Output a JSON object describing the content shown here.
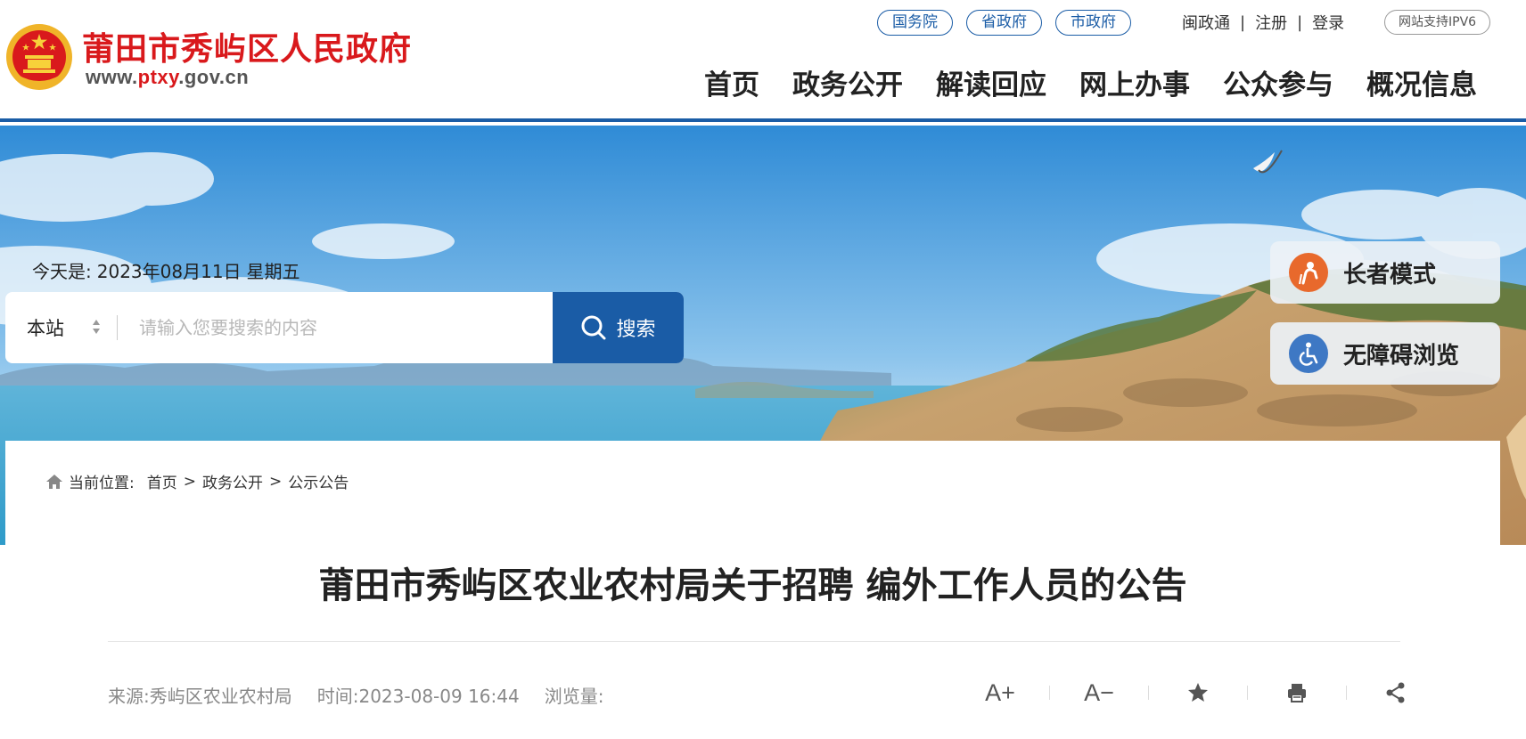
{
  "header": {
    "site_name": "莆田市秀屿区人民政府",
    "domain_prefix": "www.",
    "domain_red": "ptxy",
    "domain_suffix": ".gov.cn",
    "gov_links": [
      "国务院",
      "省政府",
      "市政府"
    ],
    "util_links": [
      "闽政通",
      "注册",
      "登录"
    ],
    "util_separator": "|",
    "ipv6_badge": "网站支持IPV6",
    "nav": [
      "首页",
      "政务公开",
      "解读回应",
      "网上办事",
      "公众参与",
      "概况信息"
    ]
  },
  "banner": {
    "today_label": "今天是:",
    "today_date": "2023年08月11日",
    "today_weekday": "星期五",
    "search_scope": "本站",
    "search_placeholder": "请输入您要搜索的内容",
    "search_button": "搜索",
    "elder_mode": "长者模式",
    "accessible_browse": "无障碍浏览"
  },
  "breadcrumb": {
    "label": "当前位置:",
    "items": [
      "首页",
      "政务公开",
      "公示公告"
    ],
    "separator": ">"
  },
  "article": {
    "title": "莆田市秀屿区农业农村局关于招聘 编外工作人员的公告",
    "source": "来源:秀屿区农业农村局",
    "time": "时间:2023-08-09 16:44",
    "views": "浏览量:"
  },
  "tools": {
    "font_larger": "A+",
    "font_smaller": "A−"
  },
  "colors": {
    "brand_blue": "#1a5ca6",
    "site_red": "#d9191c",
    "elder_orange": "#e8692c",
    "access_blue": "#3e78c4"
  }
}
